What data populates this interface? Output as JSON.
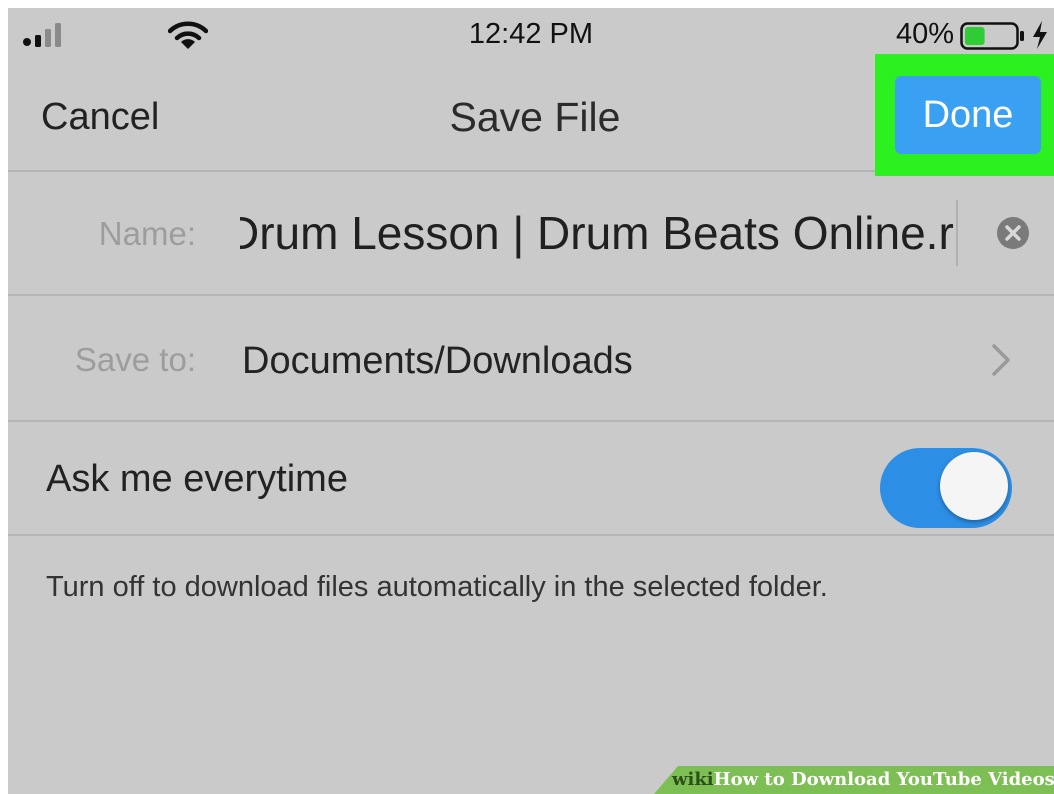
{
  "status_bar": {
    "time": "12:42 PM",
    "battery_percent": "40%",
    "battery_level": 0.4,
    "icons": [
      "signal-icon",
      "wifi-icon",
      "battery-icon",
      "charging-bolt-icon"
    ]
  },
  "nav": {
    "cancel_label": "Cancel",
    "title": "Save File",
    "done_label": "Done",
    "highlight_color": "#2cf01f",
    "done_color": "#3aa0f2"
  },
  "form": {
    "name_label": "Name:",
    "name_value": "Drum Lesson | Drum Beats Online.r",
    "save_to_label": "Save to:",
    "save_to_value": "Documents/Downloads",
    "ask_label": "Ask me everytime",
    "ask_enabled": true,
    "toggle_color": "#2d8ee6",
    "hint": "Turn off to download files automatically in the selected folder."
  },
  "watermark": {
    "brand": "wiki",
    "text": "How to Download YouTube Videos"
  }
}
